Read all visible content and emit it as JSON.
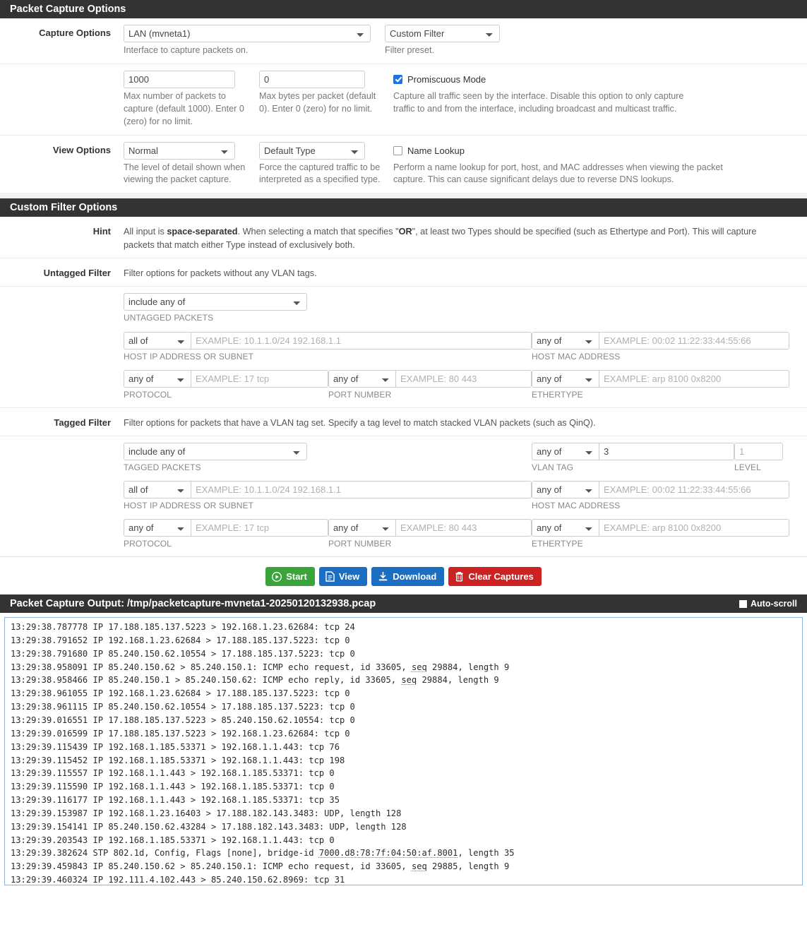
{
  "capture_panel": {
    "title": "Packet Capture Options",
    "rows": {
      "capture_options": {
        "label": "Capture Options",
        "interface_select": {
          "value": "LAN (mvneta1)",
          "help": "Interface to capture packets on."
        },
        "filter_preset_select": {
          "value": "Custom Filter",
          "help": "Filter preset."
        }
      },
      "counts": {
        "max_packets": {
          "value": "1000",
          "help": "Max number of packets to capture (default 1000). Enter 0 (zero) for no limit."
        },
        "max_bytes": {
          "value": "0",
          "help": "Max bytes per packet (default 0). Enter 0 (zero) for no limit."
        },
        "promiscuous": {
          "label": "Promiscuous Mode",
          "checked": true,
          "help": "Capture all traffic seen by the interface. Disable this option to only capture traffic to and from the interface, including broadcast and multicast traffic."
        }
      },
      "view_options": {
        "label": "View Options",
        "detail_select": {
          "value": "Normal",
          "help": "The level of detail shown when viewing the packet capture."
        },
        "type_select": {
          "value": "Default Type",
          "help": "Force the captured traffic to be interpreted as a specified type."
        },
        "name_lookup": {
          "label": "Name Lookup",
          "checked": false,
          "help": "Perform a name lookup for port, host, and MAC addresses when viewing the packet capture. This can cause significant delays due to reverse DNS lookups."
        }
      }
    }
  },
  "filter_panel": {
    "title": "Custom Filter Options",
    "hint": {
      "label": "Hint",
      "part1": "All input is ",
      "bold1": "space-separated",
      "part2": ". When selecting a match that specifies \"",
      "bold2": "OR",
      "part3": "\", at least two Types should be specified (such as Ethertype and Port). This will capture packets that match either Type instead of exclusively both."
    },
    "untagged": {
      "label": "Untagged Filter",
      "desc": "Filter options for packets without any VLAN tags.",
      "packets_select": {
        "value": "include any of",
        "caption": "UNTAGGED PACKETS"
      },
      "host_ip": {
        "match": "all of",
        "placeholder": "EXAMPLE: 10.1.1.0/24 192.168.1.1",
        "value": "",
        "caption": "HOST IP ADDRESS OR SUBNET"
      },
      "host_mac": {
        "match": "any of",
        "placeholder": "EXAMPLE: 00:02 11:22:33:44:55:66",
        "value": "",
        "caption": "HOST MAC ADDRESS"
      },
      "protocol": {
        "match": "any of",
        "placeholder": "EXAMPLE: 17 tcp",
        "value": "",
        "caption": "PROTOCOL"
      },
      "port": {
        "match": "any of",
        "placeholder": "EXAMPLE: 80 443",
        "value": "",
        "caption": "PORT NUMBER"
      },
      "ethertype": {
        "match": "any of",
        "placeholder": "EXAMPLE: arp 8100 0x8200",
        "value": "",
        "caption": "ETHERTYPE"
      }
    },
    "tagged": {
      "label": "Tagged Filter",
      "desc": "Filter options for packets that have a VLAN tag set. Specify a tag level to match stacked VLAN packets (such as QinQ).",
      "packets_select": {
        "value": "include any of",
        "caption": "TAGGED PACKETS"
      },
      "vlan_tag": {
        "match": "any of",
        "value": "3",
        "placeholder": "",
        "caption": "VLAN TAG"
      },
      "level": {
        "value": "",
        "placeholder": "1",
        "caption": "LEVEL"
      },
      "host_ip": {
        "match": "all of",
        "placeholder": "EXAMPLE: 10.1.1.0/24 192.168.1.1",
        "value": "",
        "caption": "HOST IP ADDRESS OR SUBNET"
      },
      "host_mac": {
        "match": "any of",
        "placeholder": "EXAMPLE: 00:02 11:22:33:44:55:66",
        "value": "",
        "caption": "HOST MAC ADDRESS"
      },
      "protocol": {
        "match": "any of",
        "placeholder": "EXAMPLE: 17 tcp",
        "value": "",
        "caption": "PROTOCOL"
      },
      "port": {
        "match": "any of",
        "placeholder": "EXAMPLE: 80 443",
        "value": "",
        "caption": "PORT NUMBER"
      },
      "ethertype": {
        "match": "any of",
        "placeholder": "EXAMPLE: arp 8100 0x8200",
        "value": "",
        "caption": "ETHERTYPE"
      }
    }
  },
  "buttons": {
    "start": "Start",
    "view": "View",
    "download": "Download",
    "clear": "Clear Captures"
  },
  "output_panel": {
    "title": "Packet Capture Output: /tmp/packetcapture-mvneta1-20250120132938.pcap",
    "autoscroll_label": "Auto-scroll",
    "autoscroll_checked": false,
    "lines": [
      "13:29:38.787778 IP 17.188.185.137.5223 > 192.168.1.23.62684: tcp 24",
      "13:29:38.791652 IP 192.168.1.23.62684 > 17.188.185.137.5223: tcp 0",
      "13:29:38.791680 IP 85.240.150.62.10554 > 17.188.185.137.5223: tcp 0",
      "13:29:38.958091 IP 85.240.150.62 > 85.240.150.1: ICMP echo request, id 33605, seq 29884, length 9",
      "13:29:38.958466 IP 85.240.150.1 > 85.240.150.62: ICMP echo reply, id 33605, seq 29884, length 9",
      "13:29:38.961055 IP 192.168.1.23.62684 > 17.188.185.137.5223: tcp 0",
      "13:29:38.961115 IP 85.240.150.62.10554 > 17.188.185.137.5223: tcp 0",
      "13:29:39.016551 IP 17.188.185.137.5223 > 85.240.150.62.10554: tcp 0",
      "13:29:39.016599 IP 17.188.185.137.5223 > 192.168.1.23.62684: tcp 0",
      "13:29:39.115439 IP 192.168.1.185.53371 > 192.168.1.1.443: tcp 76",
      "13:29:39.115452 IP 192.168.1.185.53371 > 192.168.1.1.443: tcp 198",
      "13:29:39.115557 IP 192.168.1.1.443 > 192.168.1.185.53371: tcp 0",
      "13:29:39.115590 IP 192.168.1.1.443 > 192.168.1.185.53371: tcp 0",
      "13:29:39.116177 IP 192.168.1.1.443 > 192.168.1.185.53371: tcp 35",
      "13:29:39.153987 IP 192.168.1.23.16403 > 17.188.182.143.3483: UDP, length 128",
      "13:29:39.154141 IP 85.240.150.62.43284 > 17.188.182.143.3483: UDP, length 128",
      "13:29:39.203543 IP 192.168.1.185.53371 > 192.168.1.1.443: tcp 0",
      "13:29:39.382624 STP 802.1d, Config, Flags [none], bridge-id 7000.d8:78:7f:04:50:af.8001, length 35",
      "13:29:39.459843 IP 85.240.150.62 > 85.240.150.1: ICMP echo request, id 33605, seq 29885, length 9",
      "13:29:39.460324 IP 192.111.4.102.443 > 85.240.150.62.8969: tcp 31"
    ]
  }
}
